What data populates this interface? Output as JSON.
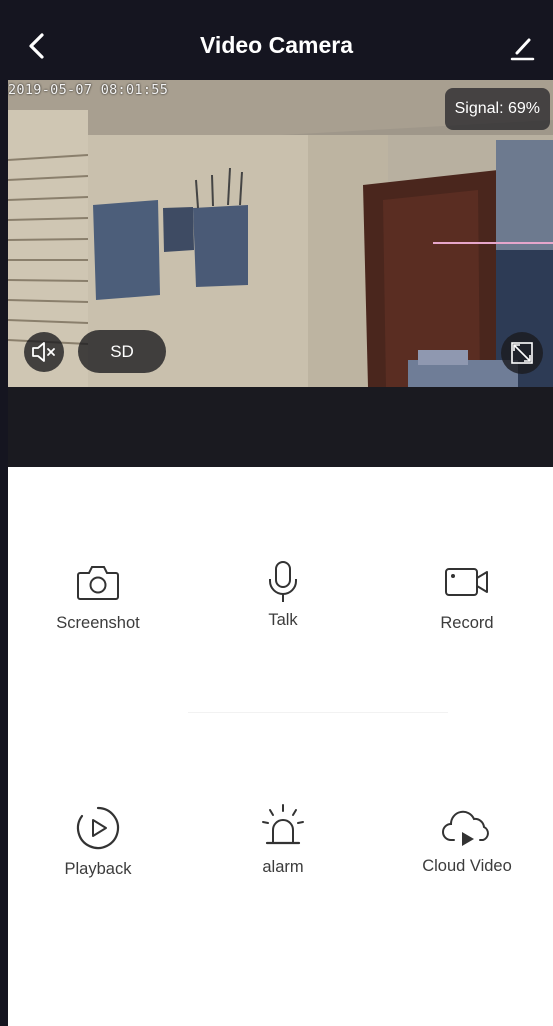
{
  "header": {
    "title": "Video Camera",
    "background": "#151520"
  },
  "video": {
    "timestamp": "2019-05-07  08:01:55",
    "signal": "Signal: 69%",
    "quality": "SD"
  },
  "controls": [
    {
      "label": "Screenshot",
      "icon": "camera-icon"
    },
    {
      "label": "Talk",
      "icon": "microphone-icon"
    },
    {
      "label": "Record",
      "icon": "video-record-icon"
    },
    {
      "label": "Playback",
      "icon": "playback-icon"
    },
    {
      "label": "alarm",
      "icon": "alarm-siren-icon"
    },
    {
      "label": "Cloud Video",
      "icon": "cloud-video-icon"
    }
  ]
}
